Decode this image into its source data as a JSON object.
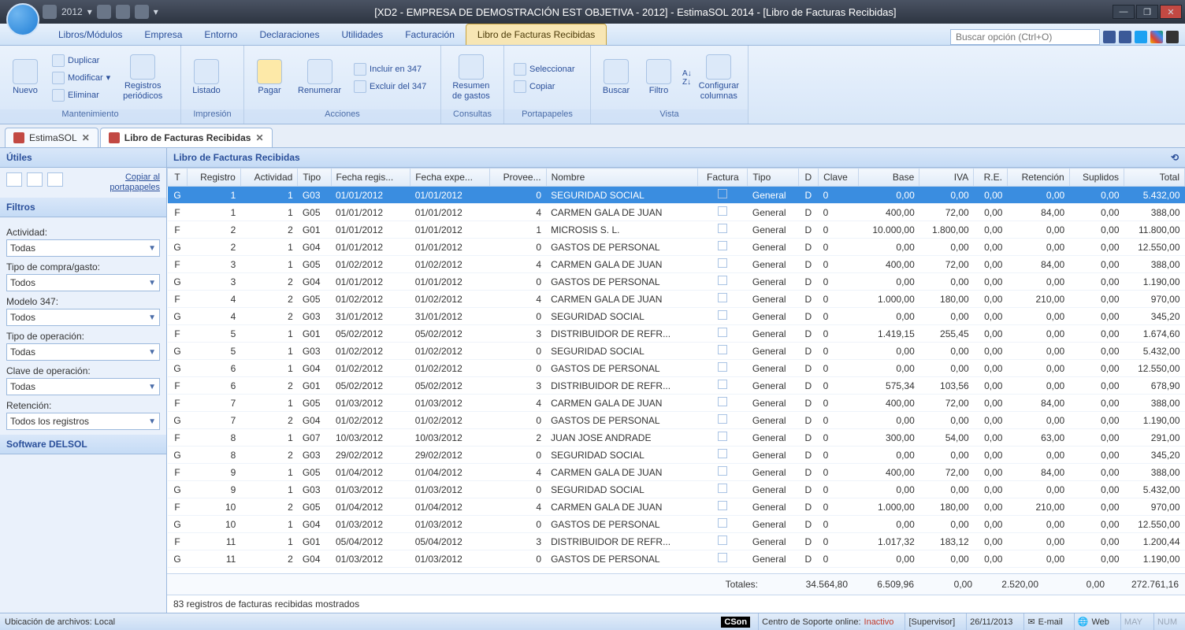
{
  "titlebar": {
    "year": "2012",
    "title": "[XD2 - EMPRESA DE DEMOSTRACIÓN EST OBJETIVA - 2012] - EstimaSOL 2014 - [Libro de Facturas Recibidas]"
  },
  "menu": {
    "tabs": [
      "Libros/Módulos",
      "Empresa",
      "Entorno",
      "Declaraciones",
      "Utilidades",
      "Facturación",
      "Libro de Facturas Recibidas"
    ],
    "active": 6,
    "search_placeholder": "Buscar opción (Ctrl+O)"
  },
  "ribbon": {
    "groups": [
      {
        "label": "Mantenimiento",
        "big": [
          {
            "name": "nuevo",
            "text": "Nuevo"
          }
        ],
        "small": [
          "Duplicar",
          "Modificar",
          "Eliminar"
        ],
        "big2": [
          {
            "name": "registros",
            "text": "Registros\nperiódicos"
          }
        ]
      },
      {
        "label": "Impresión",
        "big": [
          {
            "name": "listado",
            "text": "Listado"
          }
        ]
      },
      {
        "label": "Acciones",
        "big": [
          {
            "name": "pagar",
            "text": "Pagar"
          },
          {
            "name": "renumerar",
            "text": "Renumerar"
          }
        ],
        "small": [
          "Incluir en 347",
          "Excluir del 347"
        ]
      },
      {
        "label": "Consultas",
        "big": [
          {
            "name": "resumen",
            "text": "Resumen\nde gastos"
          }
        ]
      },
      {
        "label": "Portapapeles",
        "small": [
          "Seleccionar",
          "Copiar"
        ]
      },
      {
        "label": "Vista",
        "big": [
          {
            "name": "buscar",
            "text": "Buscar"
          },
          {
            "name": "filtro",
            "text": "Filtro"
          },
          {
            "name": "orden",
            "text": ""
          },
          {
            "name": "configurar",
            "text": "Configurar\ncolumnas"
          }
        ]
      }
    ]
  },
  "doctabs": [
    {
      "label": "EstimaSOL",
      "active": false
    },
    {
      "label": "Libro de Facturas Recibidas",
      "active": true
    }
  ],
  "sidebar": {
    "utiles": "Útiles",
    "copiar_link": "Copiar al\nportapapeles",
    "filtros": "Filtros",
    "filters": [
      {
        "label": "Actividad:",
        "value": "Todas"
      },
      {
        "label": "Tipo de compra/gasto:",
        "value": "Todos"
      },
      {
        "label": "Modelo 347:",
        "value": "Todos"
      },
      {
        "label": "Tipo de operación:",
        "value": "Todas"
      },
      {
        "label": "Clave de operación:",
        "value": "Todas"
      },
      {
        "label": "Retención:",
        "value": "Todos los registros"
      }
    ],
    "software": "Software DELSOL"
  },
  "content_title": "Libro de Facturas Recibidas",
  "columns": [
    "T",
    "Registro",
    "Actividad",
    "Tipo",
    "Fecha regis...",
    "Fecha expe...",
    "Provee...",
    "Nombre",
    "Factura",
    "Tipo",
    "D",
    "Clave",
    "Base",
    "IVA",
    "R.E.",
    "Retención",
    "Suplidos",
    "Total"
  ],
  "rows": [
    [
      "G",
      "1",
      "1",
      "G03",
      "01/01/2012",
      "01/01/2012",
      "0",
      "SEGURIDAD SOCIAL",
      true,
      "General",
      "D",
      "0",
      "0,00",
      "0,00",
      "0,00",
      "0,00",
      "0,00",
      "5.432,00"
    ],
    [
      "F",
      "1",
      "1",
      "G05",
      "01/01/2012",
      "01/01/2012",
      "4",
      "CARMEN GALA DE JUAN",
      false,
      "General",
      "D",
      "0",
      "400,00",
      "72,00",
      "0,00",
      "84,00",
      "0,00",
      "388,00"
    ],
    [
      "F",
      "2",
      "2",
      "G01",
      "01/01/2012",
      "01/01/2012",
      "1",
      "MICROSIS S. L.",
      false,
      "General",
      "D",
      "0",
      "10.000,00",
      "1.800,00",
      "0,00",
      "0,00",
      "0,00",
      "11.800,00"
    ],
    [
      "G",
      "2",
      "1",
      "G04",
      "01/01/2012",
      "01/01/2012",
      "0",
      "GASTOS DE PERSONAL",
      false,
      "General",
      "D",
      "0",
      "0,00",
      "0,00",
      "0,00",
      "0,00",
      "0,00",
      "12.550,00"
    ],
    [
      "F",
      "3",
      "1",
      "G05",
      "01/02/2012",
      "01/02/2012",
      "4",
      "CARMEN GALA DE JUAN",
      false,
      "General",
      "D",
      "0",
      "400,00",
      "72,00",
      "0,00",
      "84,00",
      "0,00",
      "388,00"
    ],
    [
      "G",
      "3",
      "2",
      "G04",
      "01/01/2012",
      "01/01/2012",
      "0",
      "GASTOS DE PERSONAL",
      false,
      "General",
      "D",
      "0",
      "0,00",
      "0,00",
      "0,00",
      "0,00",
      "0,00",
      "1.190,00"
    ],
    [
      "F",
      "4",
      "2",
      "G05",
      "01/02/2012",
      "01/02/2012",
      "4",
      "CARMEN GALA DE JUAN",
      false,
      "General",
      "D",
      "0",
      "1.000,00",
      "180,00",
      "0,00",
      "210,00",
      "0,00",
      "970,00"
    ],
    [
      "G",
      "4",
      "2",
      "G03",
      "31/01/2012",
      "31/01/2012",
      "0",
      "SEGURIDAD SOCIAL",
      false,
      "General",
      "D",
      "0",
      "0,00",
      "0,00",
      "0,00",
      "0,00",
      "0,00",
      "345,20"
    ],
    [
      "F",
      "5",
      "1",
      "G01",
      "05/02/2012",
      "05/02/2012",
      "3",
      "DISTRIBUIDOR DE REFR...",
      false,
      "General",
      "D",
      "0",
      "1.419,15",
      "255,45",
      "0,00",
      "0,00",
      "0,00",
      "1.674,60"
    ],
    [
      "G",
      "5",
      "1",
      "G03",
      "01/02/2012",
      "01/02/2012",
      "0",
      "SEGURIDAD SOCIAL",
      false,
      "General",
      "D",
      "0",
      "0,00",
      "0,00",
      "0,00",
      "0,00",
      "0,00",
      "5.432,00"
    ],
    [
      "G",
      "6",
      "1",
      "G04",
      "01/02/2012",
      "01/02/2012",
      "0",
      "GASTOS DE PERSONAL",
      false,
      "General",
      "D",
      "0",
      "0,00",
      "0,00",
      "0,00",
      "0,00",
      "0,00",
      "12.550,00"
    ],
    [
      "F",
      "6",
      "2",
      "G01",
      "05/02/2012",
      "05/02/2012",
      "3",
      "DISTRIBUIDOR DE REFR...",
      false,
      "General",
      "D",
      "0",
      "575,34",
      "103,56",
      "0,00",
      "0,00",
      "0,00",
      "678,90"
    ],
    [
      "F",
      "7",
      "1",
      "G05",
      "01/03/2012",
      "01/03/2012",
      "4",
      "CARMEN GALA DE JUAN",
      false,
      "General",
      "D",
      "0",
      "400,00",
      "72,00",
      "0,00",
      "84,00",
      "0,00",
      "388,00"
    ],
    [
      "G",
      "7",
      "2",
      "G04",
      "01/02/2012",
      "01/02/2012",
      "0",
      "GASTOS DE PERSONAL",
      false,
      "General",
      "D",
      "0",
      "0,00",
      "0,00",
      "0,00",
      "0,00",
      "0,00",
      "1.190,00"
    ],
    [
      "F",
      "8",
      "1",
      "G07",
      "10/03/2012",
      "10/03/2012",
      "2",
      "JUAN JOSE ANDRADE",
      false,
      "General",
      "D",
      "0",
      "300,00",
      "54,00",
      "0,00",
      "63,00",
      "0,00",
      "291,00"
    ],
    [
      "G",
      "8",
      "2",
      "G03",
      "29/02/2012",
      "29/02/2012",
      "0",
      "SEGURIDAD SOCIAL",
      false,
      "General",
      "D",
      "0",
      "0,00",
      "0,00",
      "0,00",
      "0,00",
      "0,00",
      "345,20"
    ],
    [
      "F",
      "9",
      "1",
      "G05",
      "01/04/2012",
      "01/04/2012",
      "4",
      "CARMEN GALA DE JUAN",
      false,
      "General",
      "D",
      "0",
      "400,00",
      "72,00",
      "0,00",
      "84,00",
      "0,00",
      "388,00"
    ],
    [
      "G",
      "9",
      "1",
      "G03",
      "01/03/2012",
      "01/03/2012",
      "0",
      "SEGURIDAD SOCIAL",
      false,
      "General",
      "D",
      "0",
      "0,00",
      "0,00",
      "0,00",
      "0,00",
      "0,00",
      "5.432,00"
    ],
    [
      "F",
      "10",
      "2",
      "G05",
      "01/04/2012",
      "01/04/2012",
      "4",
      "CARMEN GALA DE JUAN",
      false,
      "General",
      "D",
      "0",
      "1.000,00",
      "180,00",
      "0,00",
      "210,00",
      "0,00",
      "970,00"
    ],
    [
      "G",
      "10",
      "1",
      "G04",
      "01/03/2012",
      "01/03/2012",
      "0",
      "GASTOS DE PERSONAL",
      false,
      "General",
      "D",
      "0",
      "0,00",
      "0,00",
      "0,00",
      "0,00",
      "0,00",
      "12.550,00"
    ],
    [
      "F",
      "11",
      "1",
      "G01",
      "05/04/2012",
      "05/04/2012",
      "3",
      "DISTRIBUIDOR DE REFR...",
      false,
      "General",
      "D",
      "0",
      "1.017,32",
      "183,12",
      "0,00",
      "0,00",
      "0,00",
      "1.200,44"
    ],
    [
      "G",
      "11",
      "2",
      "G04",
      "01/03/2012",
      "01/03/2012",
      "0",
      "GASTOS DE PERSONAL",
      false,
      "General",
      "D",
      "0",
      "0,00",
      "0,00",
      "0,00",
      "0,00",
      "0,00",
      "1.190,00"
    ]
  ],
  "selected_row": 0,
  "totals": {
    "label": "Totales:",
    "base": "34.564,80",
    "iva": "6.509,96",
    "re": "0,00",
    "ret": "2.520,00",
    "sup": "0,00",
    "total": "272.761,16"
  },
  "record_status": "83 registros de facturas recibidas mostrados",
  "statusbar": {
    "location": "Ubicación de archivos: Local",
    "cs": "CSon",
    "support_label": "Centro de Soporte online:",
    "support_status": "Inactivo",
    "user": "[Supervisor]",
    "date": "26/11/2013",
    "email": "E-mail",
    "web": "Web",
    "may": "MAY",
    "num": "NUM"
  }
}
